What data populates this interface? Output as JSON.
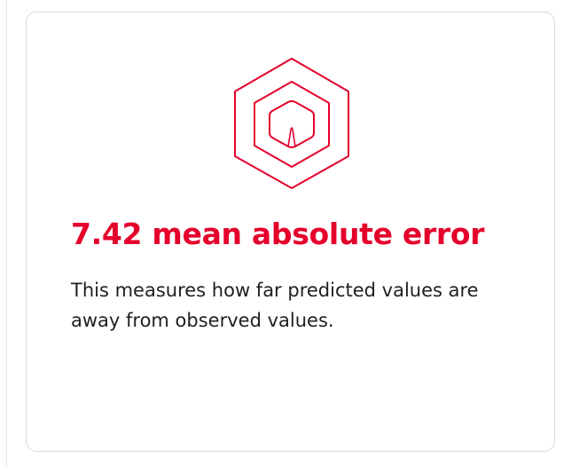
{
  "card": {
    "icon": "hexagon-target-icon",
    "title": "7.42 mean absolute error",
    "description": "This measures how far predicted values are away from observed values."
  },
  "colors": {
    "accent": "#e4002b",
    "text": "#1f1f1f",
    "border": "#d9d9d9"
  }
}
